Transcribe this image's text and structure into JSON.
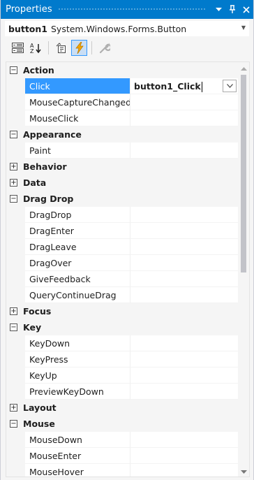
{
  "window": {
    "title": "Properties",
    "pin_glyph": "▾",
    "autohide_glyph": "ᵖ",
    "close_glyph": "✕"
  },
  "object_selector": {
    "name": "button1",
    "type": "System.Windows.Forms.Button"
  },
  "toolbar": {
    "buttons": [
      {
        "icon": "categorized-icon",
        "active": false
      },
      {
        "icon": "alphabetical-icon",
        "active": false
      },
      {
        "icon": "properties-icon",
        "active": false
      },
      {
        "icon": "events-lightning-icon",
        "active": true
      },
      {
        "icon": "property-pages-wrench-icon",
        "active": false
      }
    ]
  },
  "grid": {
    "rows": [
      {
        "kind": "cat",
        "label": "Action",
        "expanded": true
      },
      {
        "kind": "prop",
        "label": "Click",
        "value": "button1_Click",
        "selected": true
      },
      {
        "kind": "prop",
        "label": "MouseCaptureChanged",
        "value": ""
      },
      {
        "kind": "prop",
        "label": "MouseClick",
        "value": ""
      },
      {
        "kind": "cat",
        "label": "Appearance",
        "expanded": true
      },
      {
        "kind": "prop",
        "label": "Paint",
        "value": ""
      },
      {
        "kind": "cat",
        "label": "Behavior",
        "expanded": false
      },
      {
        "kind": "cat",
        "label": "Data",
        "expanded": false
      },
      {
        "kind": "cat",
        "label": "Drag Drop",
        "expanded": true
      },
      {
        "kind": "prop",
        "label": "DragDrop",
        "value": ""
      },
      {
        "kind": "prop",
        "label": "DragEnter",
        "value": ""
      },
      {
        "kind": "prop",
        "label": "DragLeave",
        "value": ""
      },
      {
        "kind": "prop",
        "label": "DragOver",
        "value": ""
      },
      {
        "kind": "prop",
        "label": "GiveFeedback",
        "value": ""
      },
      {
        "kind": "prop",
        "label": "QueryContinueDrag",
        "value": ""
      },
      {
        "kind": "cat",
        "label": "Focus",
        "expanded": false
      },
      {
        "kind": "cat",
        "label": "Key",
        "expanded": true
      },
      {
        "kind": "prop",
        "label": "KeyDown",
        "value": ""
      },
      {
        "kind": "prop",
        "label": "KeyPress",
        "value": ""
      },
      {
        "kind": "prop",
        "label": "KeyUp",
        "value": ""
      },
      {
        "kind": "prop",
        "label": "PreviewKeyDown",
        "value": ""
      },
      {
        "kind": "cat",
        "label": "Layout",
        "expanded": false
      },
      {
        "kind": "cat",
        "label": "Mouse",
        "expanded": true
      },
      {
        "kind": "prop",
        "label": "MouseDown",
        "value": ""
      },
      {
        "kind": "prop",
        "label": "MouseEnter",
        "value": ""
      },
      {
        "kind": "prop",
        "label": "MouseHover",
        "value": ""
      }
    ]
  },
  "colors": {
    "title_bar": "#007acc",
    "selection": "#3399ff",
    "active_tool": "#c9def5"
  }
}
